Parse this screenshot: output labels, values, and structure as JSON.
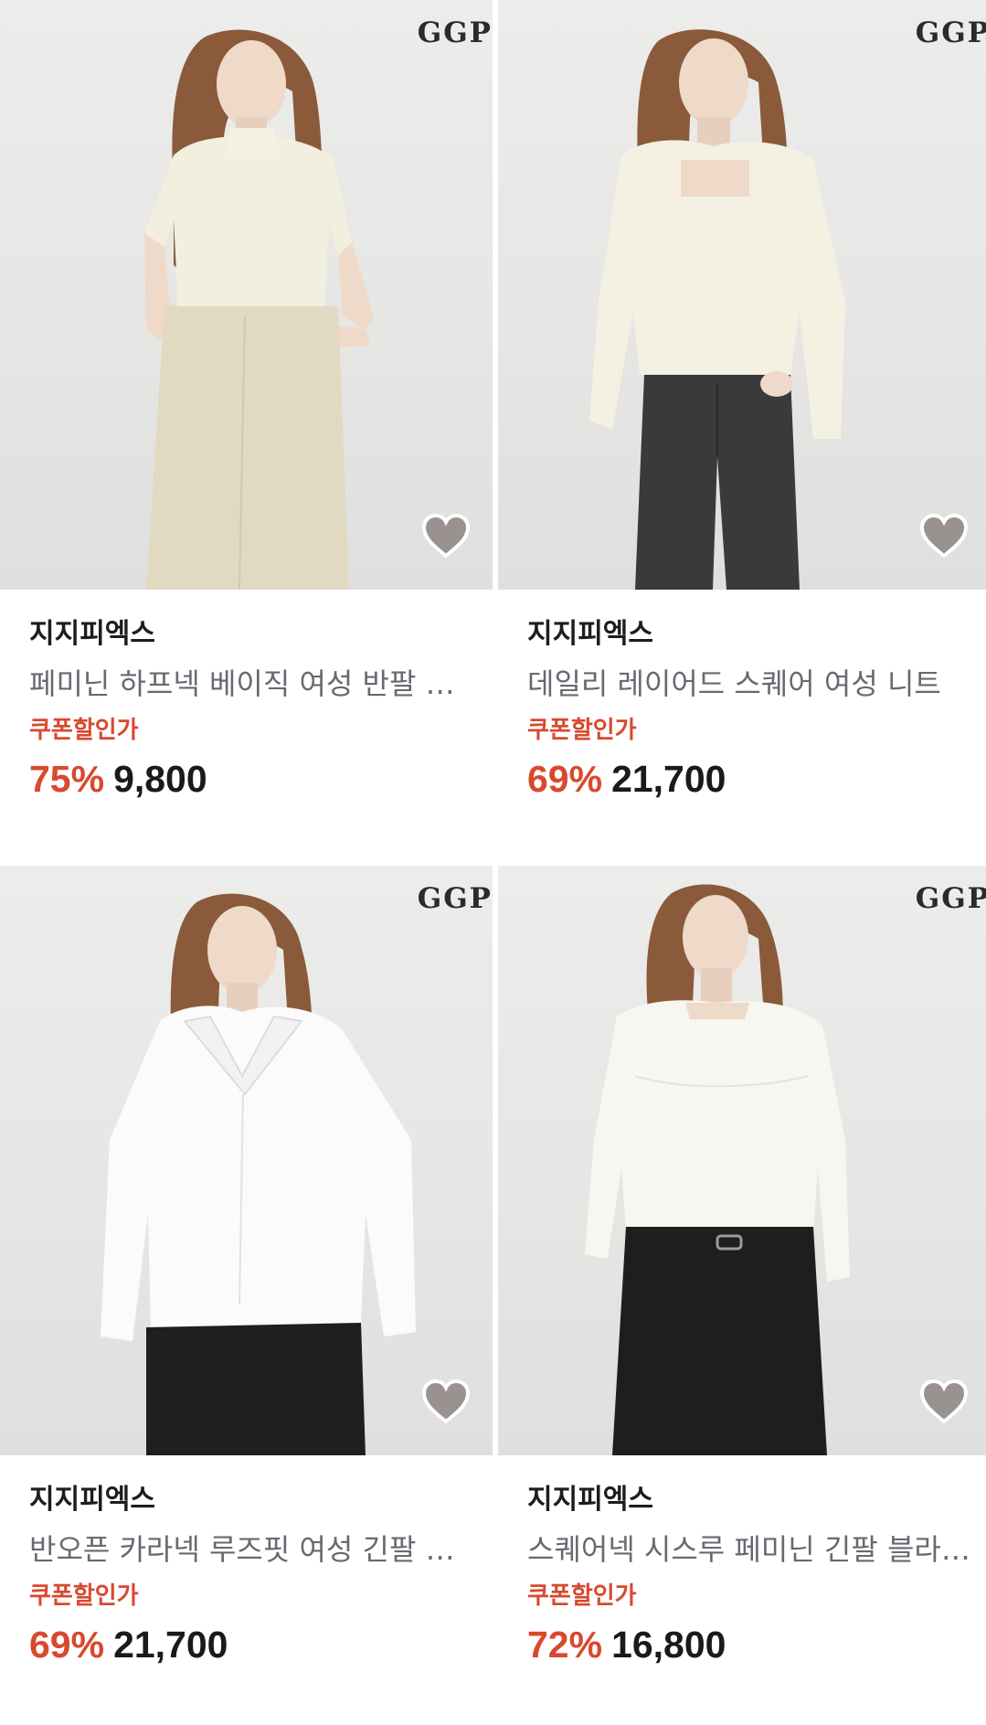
{
  "products": [
    {
      "logo": "GGP",
      "brand": "지지피엑스",
      "title": "페미닌 하프넥 베이직 여성 반팔 니트",
      "coupon_label": "쿠폰할인가",
      "discount": "75%",
      "price": "9,800",
      "wishlist_icon": "heart-icon"
    },
    {
      "logo": "GGP",
      "brand": "지지피엑스",
      "title": "데일리 레이어드 스퀘어 여성 니트",
      "coupon_label": "쿠폰할인가",
      "discount": "69%",
      "price": "21,700",
      "wishlist_icon": "heart-icon"
    },
    {
      "logo": "GGP",
      "brand": "지지피엑스",
      "title": "반오픈 카라넥 루즈핏 여성 긴팔 블라우스",
      "coupon_label": "쿠폰할인가",
      "discount": "69%",
      "price": "21,700",
      "wishlist_icon": "heart-icon"
    },
    {
      "logo": "GGP",
      "brand": "지지피엑스",
      "title": "스퀘어넥 시스루 페미닌 긴팔 블라우스",
      "coupon_label": "쿠폰할인가",
      "discount": "72%",
      "price": "16,800",
      "wishlist_icon": "heart-icon"
    }
  ],
  "colors": {
    "accent": "#d8492e",
    "brand_text": "#1d1d1d",
    "title_text": "#666a70",
    "photo_bg": "#e6e6e4"
  }
}
